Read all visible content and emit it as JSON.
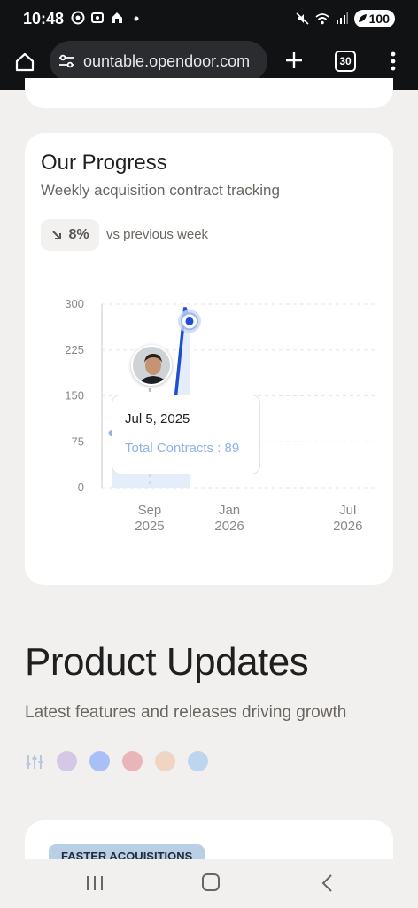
{
  "status_bar": {
    "time": "10:48",
    "battery": "100",
    "left_icons": [
      "chrome-icon",
      "screenshot-icon",
      "home-app-icon",
      "dot-icon"
    ],
    "right_icons": [
      "mute-icon",
      "wifi-icon",
      "signal-icon",
      "battery-icon"
    ]
  },
  "browser": {
    "url": "ountable.opendoor.com",
    "tab_count": "30",
    "icons": [
      "home-icon",
      "site-settings-icon",
      "new-tab-icon",
      "tabs-icon",
      "menu-icon"
    ]
  },
  "progress_card": {
    "title": "Our Progress",
    "subtitle": "Weekly acquisition contract tracking",
    "change_percent": "8%",
    "change_direction": "down",
    "change_label": "vs previous week",
    "tooltip": {
      "date": "Jul 5, 2025",
      "label": "Total Contracts : 89"
    }
  },
  "chart_data": {
    "type": "area",
    "y_ticks": [
      "300",
      "225",
      "150",
      "75",
      "0"
    ],
    "x_ticks": [
      {
        "line1": "Sep",
        "line2": "2025"
      },
      {
        "line1": "Jan",
        "line2": "2026"
      },
      {
        "line1": "Jul",
        "line2": "2026"
      }
    ],
    "ylim": [
      0,
      300
    ],
    "grid": true,
    "series": [
      {
        "color": "#1f4fd1",
        "highlight_color": "#8fb3e8",
        "points": [
          {
            "x": "2025-07-05",
            "y": 89
          },
          {
            "x": "2025-07-19",
            "y": 100
          },
          {
            "x": "2025-08-02",
            "y": 101
          },
          {
            "x": "2025-08-16",
            "y": 100
          },
          {
            "x": "2025-08-30",
            "y": 100
          },
          {
            "x": "2025-09-13",
            "y": 95
          },
          {
            "x": "2025-09-27",
            "y": 115
          },
          {
            "x": "2025-10-11",
            "y": 150
          },
          {
            "x": "2025-10-25",
            "y": 295
          },
          {
            "x": "2025-11-01",
            "y": 272
          }
        ]
      }
    ]
  },
  "product_updates": {
    "title": "Product Updates",
    "subtitle": "Latest features and releases driving growth",
    "filter_colors": [
      "#d4c8e6",
      "#a9c0f7",
      "#eab5b9",
      "#f0d5c2",
      "#bdd5ee"
    ],
    "card_tag": "FASTER ACQUISITIONS"
  },
  "nav": {
    "icons": [
      "recent-apps-icon",
      "home-button-icon",
      "back-icon"
    ]
  }
}
